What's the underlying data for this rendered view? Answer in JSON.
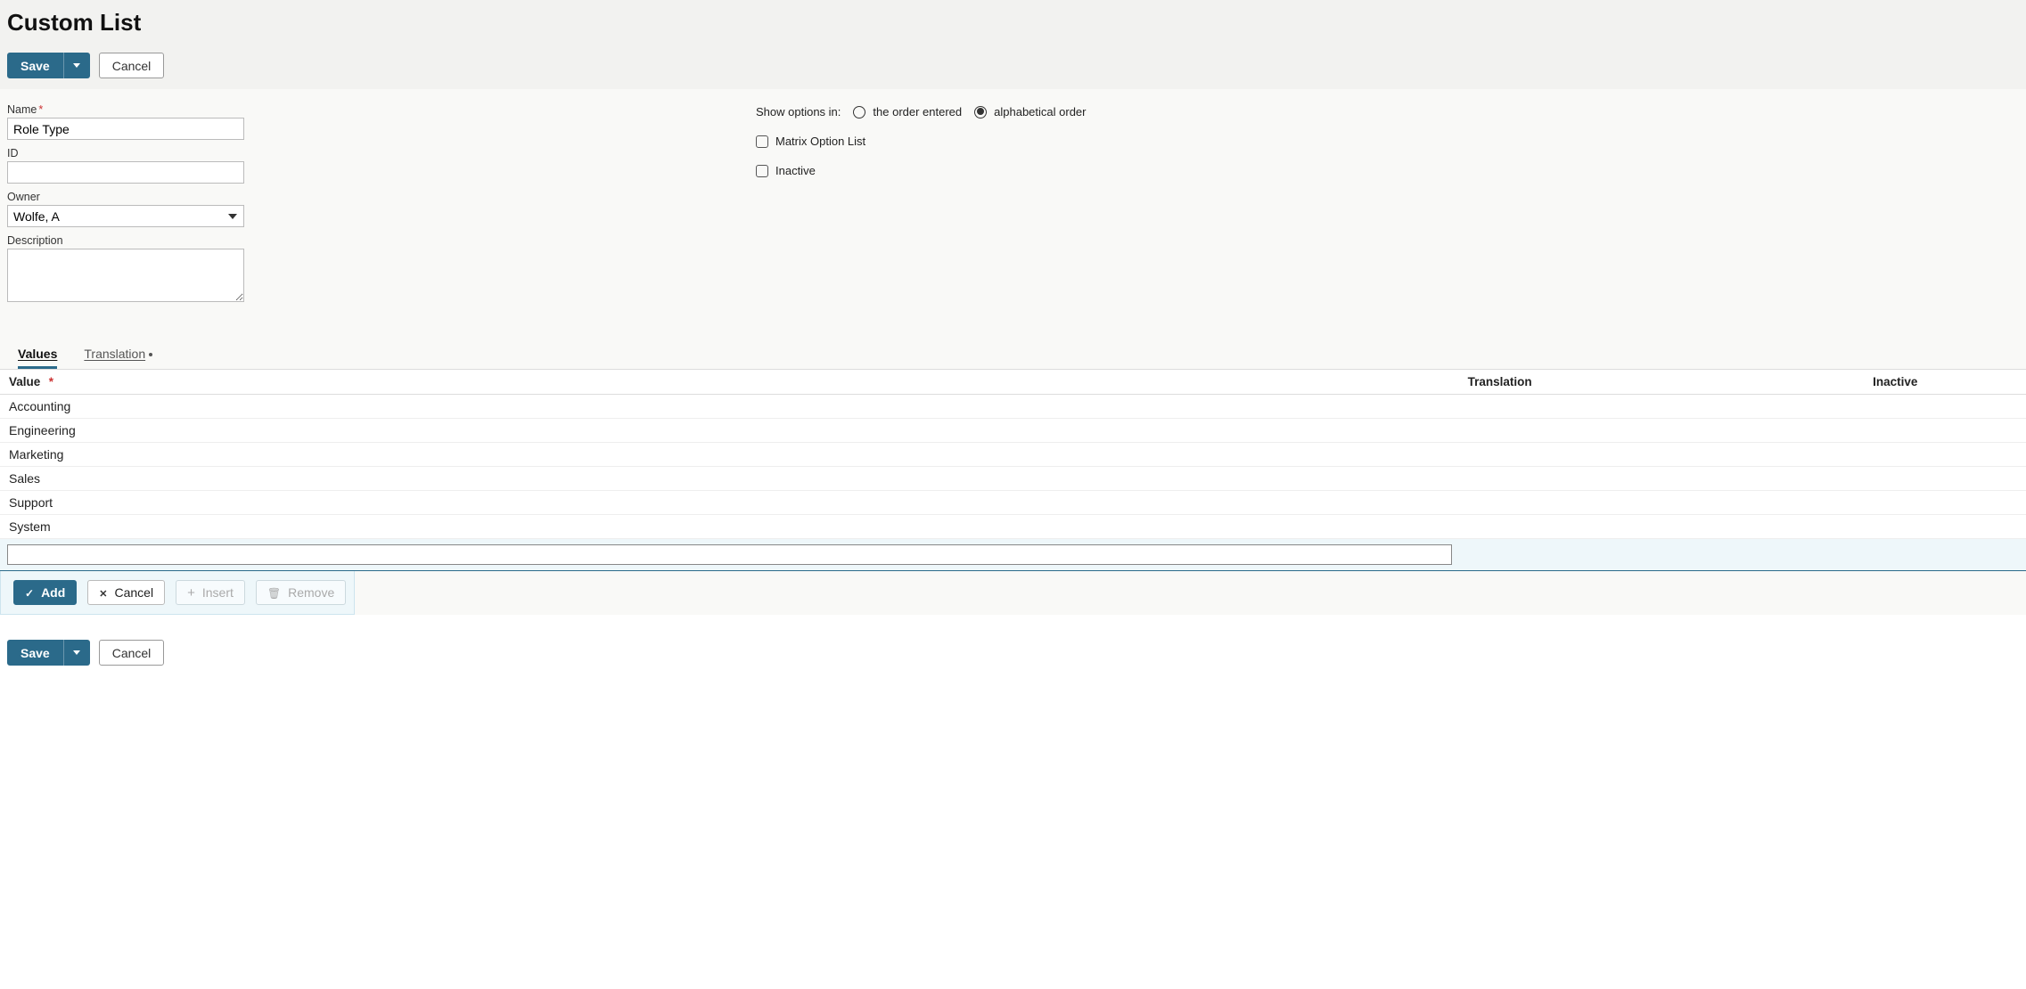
{
  "page": {
    "title": "Custom List"
  },
  "toolbar": {
    "save_label": "Save",
    "cancel_label": "Cancel"
  },
  "form": {
    "name_label": "Name",
    "name_value": "Role Type",
    "id_label": "ID",
    "id_value": "",
    "owner_label": "Owner",
    "owner_value": "Wolfe, A",
    "description_label": "Description",
    "description_value": "",
    "show_options_label": "Show options in:",
    "order_entered_label": "the order entered",
    "alphabetical_label": "alphabetical order",
    "matrix_label": "Matrix Option List",
    "inactive_label": "Inactive"
  },
  "tabs": {
    "values": "Values",
    "translation": "Translation"
  },
  "table": {
    "headers": {
      "value": "Value",
      "translation": "Translation",
      "inactive": "Inactive"
    },
    "rows": [
      {
        "value": "Accounting",
        "translation": "",
        "inactive": ""
      },
      {
        "value": "Engineering",
        "translation": "",
        "inactive": ""
      },
      {
        "value": "Marketing",
        "translation": "",
        "inactive": ""
      },
      {
        "value": "Sales",
        "translation": "",
        "inactive": ""
      },
      {
        "value": "Support",
        "translation": "",
        "inactive": ""
      },
      {
        "value": "System",
        "translation": "",
        "inactive": ""
      }
    ],
    "edit_value": ""
  },
  "row_actions": {
    "add": "Add",
    "cancel": "Cancel",
    "insert": "Insert",
    "remove": "Remove"
  }
}
